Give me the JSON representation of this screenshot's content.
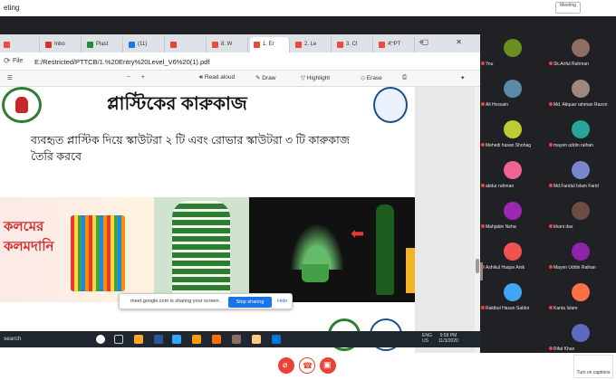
{
  "meet": {
    "title_fragment": "eting",
    "top_right_label": "Meeting"
  },
  "browser": {
    "tabs": [
      {
        "label": "",
        "color": "#e74c3c"
      },
      {
        "label": "Inbo",
        "color": "#d93025"
      },
      {
        "label": "Plast",
        "color": "#1e8e3e"
      },
      {
        "label": "(11)",
        "color": "#1877f2"
      },
      {
        "label": "",
        "color": "#ea4335"
      },
      {
        "label": "8. W",
        "color": "#e74c3c"
      },
      {
        "label": "1. Er",
        "color": "#e74c3c"
      },
      {
        "label": "2. Le",
        "color": "#e74c3c"
      },
      {
        "label": "3. Cl",
        "color": "#e74c3c"
      },
      {
        "label": "4. PT",
        "color": "#e74c3c"
      }
    ],
    "active_tab_index": 6,
    "address_label": "File",
    "url": "E:/Restricted/PTTCB/1.%20Entry%20Level_V6%20(1).pdf",
    "pdf_toolbar": {
      "read_aloud": "Read aloud",
      "draw": "Draw",
      "highlight": "Highlight",
      "erase": "Erase"
    }
  },
  "pdf": {
    "title": "প্লাস্টিকের কারুকাজ",
    "body": "ব্যবহৃত প্লাস্টিক দিয়ে স্কাউটরা ২ টি এবং রোভার স্কাউটরা ৩ টি কারুকাজ তৈরি করবে",
    "image_caption": "কলমের কলমদানি"
  },
  "share_notice": {
    "message": "meet.google.com is sharing your screen.",
    "stop_label": "Stop sharing",
    "hide_label": "Hide"
  },
  "taskbar": {
    "search": "search",
    "lang": "ENG\nUS",
    "time": "9:58 PM",
    "date": "11/3/2020"
  },
  "participants": [
    {
      "name": "You",
      "color": "#6b8e23"
    },
    {
      "name": "Sk.Ariful Rahman",
      "color": "#8d6e63"
    },
    {
      "name": "Ali Hossain",
      "color": "#5d8aa8"
    },
    {
      "name": "Md. Atiquar rahman Razon",
      "color": "#a1887f"
    },
    {
      "name": "Mehedi hasan Shohag",
      "color": "#c0ca33"
    },
    {
      "name": "mayen uddin raihan",
      "color": "#26a69a"
    },
    {
      "name": "abdur rahman",
      "color": "#f06292"
    },
    {
      "name": "Md.Faridul Islam Farid",
      "color": "#7986cb"
    },
    {
      "name": "Mahjabin Neha",
      "color": "#9c27b0"
    },
    {
      "name": "khani das",
      "color": "#6d4c41"
    },
    {
      "name": "Ashikul Haque Anik",
      "color": "#ef5350"
    },
    {
      "name": "Mayen Uddin Raihan",
      "color": "#8e24aa"
    },
    {
      "name": "Rakibul Hasan Sabbir",
      "color": "#42a5f5"
    },
    {
      "name": "Kanta Islam",
      "color": "#ff7043"
    },
    {
      "name": "",
      "color": "#202124"
    },
    {
      "name": "Rifat Khan",
      "color": "#5c6bc0"
    }
  ],
  "captions_label": "Turn on captions",
  "colors": {
    "accent": "#1a73e8",
    "danger": "#ea4335"
  }
}
